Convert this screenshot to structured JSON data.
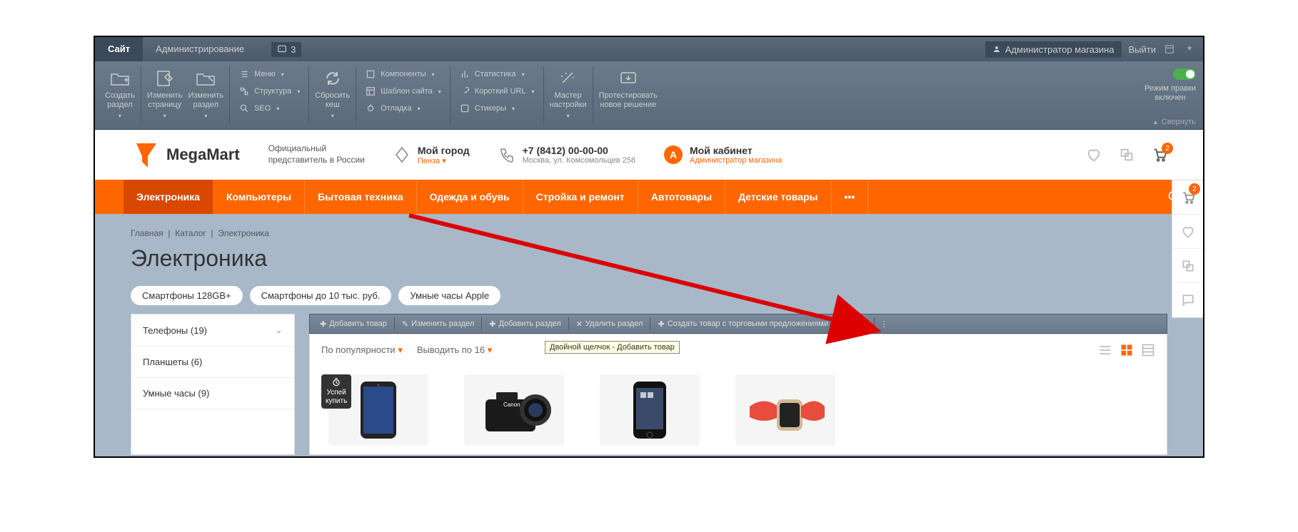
{
  "admin": {
    "tabs": {
      "site": "Сайт",
      "admin": "Администрирование"
    },
    "notif_count": "3",
    "user_label": "Администратор магазина",
    "logout": "Выйти"
  },
  "ribbon": {
    "create_section": "Создать\nраздел",
    "edit_page": "Изменить\nстраницу",
    "edit_section": "Изменить\nраздел",
    "menu_row1": "Меню",
    "menu_row2": "Структура",
    "menu_row3": "SEO",
    "reset_cache": "Сбросить\nкеш",
    "components": "Компоненты",
    "site_template": "Шаблон сайта",
    "debug": "Отладка",
    "statistics": "Статистика",
    "short_url": "Короткий URL",
    "stickers": "Стикеры",
    "wizard": "Мастер\nнастройки",
    "test_solution": "Протестировать\nновое решение",
    "edit_mode_line1": "Режим правки",
    "edit_mode_line2": "включен",
    "collapse": "Свернуть"
  },
  "header": {
    "logo": "MegaMart",
    "logo_sub": "Официальный\nпредставитель в России",
    "city_label": "Мой город",
    "city_value": "Пенза",
    "phone": "+7 (8412) 00-00-00",
    "address": "Москва, ул. Комсомольцев 258",
    "cabinet": "Мой кабинет",
    "cabinet_user": "Администратор магазина",
    "cart_badge": "2"
  },
  "nav": {
    "items": [
      "Электроника",
      "Компьютеры",
      "Бытовая техника",
      "Одежда и обувь",
      "Стройка и ремонт",
      "Автотовары",
      "Детские товары"
    ],
    "more": "•••"
  },
  "breadcrumb": {
    "home": "Главная",
    "catalog": "Каталог",
    "current": "Электроника"
  },
  "page_title": "Электроника",
  "tags": [
    "Смартфоны 128GB+",
    "Смартфоны до 10 тыс. руб.",
    "Умные часы Apple"
  ],
  "categories": [
    {
      "label": "Телефоны (19)",
      "expandable": true
    },
    {
      "label": "Планшеты (6)",
      "expandable": false
    },
    {
      "label": "Умные часы (9)",
      "expandable": false
    }
  ],
  "edit_toolbar": {
    "add_product": "Добавить товар",
    "edit_section": "Изменить раздел",
    "add_section": "Добавить раздел",
    "delete_section": "Удалить раздел",
    "create_offer": "Создать товар с торговыми предложениями"
  },
  "product_controls": {
    "sort": "По популярности",
    "per_page": "Выводить по 16"
  },
  "tooltip": "Двойной щелчок - Добавить товар",
  "promo_badge": "Успей\nкупить",
  "fixed_sidebar": {
    "cart_badge": "2"
  }
}
